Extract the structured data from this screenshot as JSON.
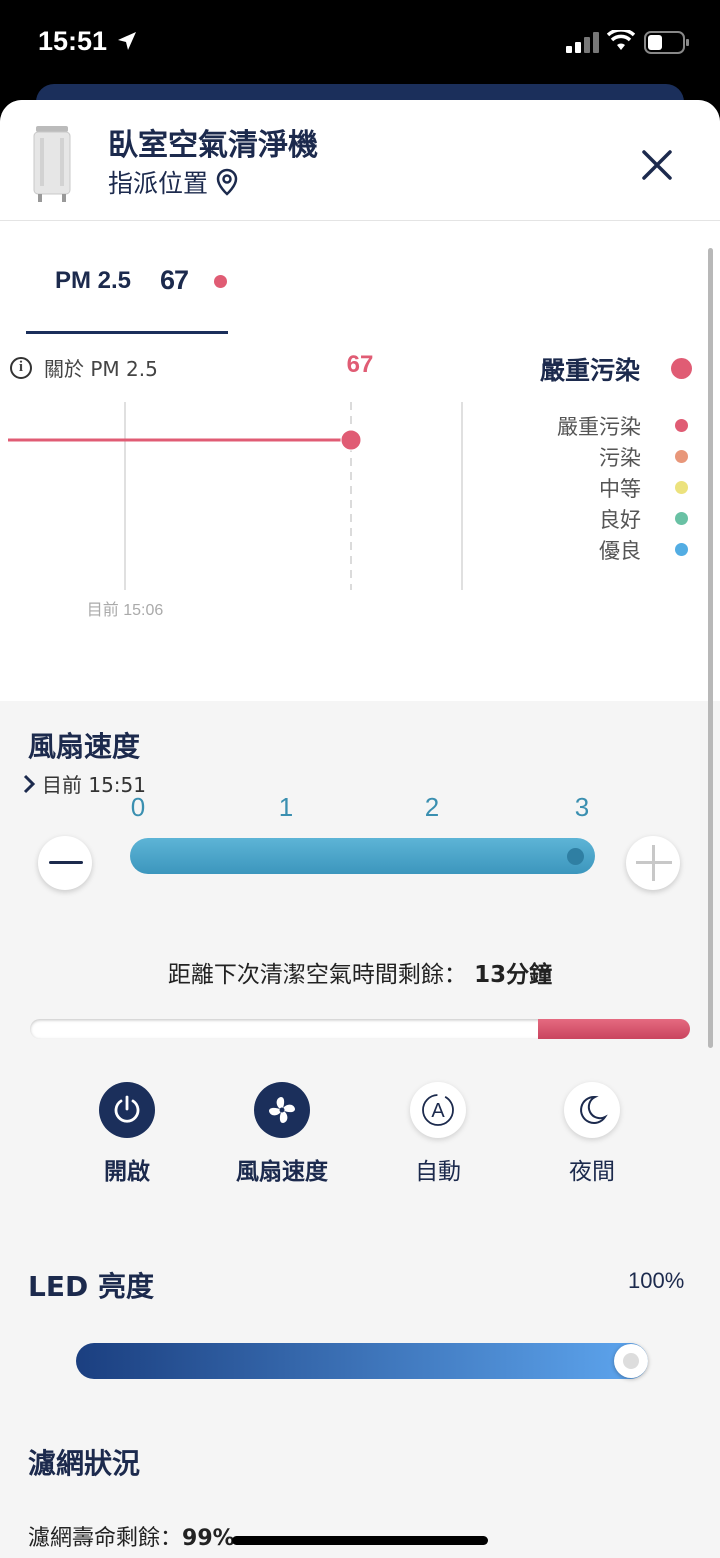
{
  "status_bar": {
    "time": "15:51"
  },
  "header": {
    "device_name": "臥室空氣清淨機",
    "location_label": "指派位置"
  },
  "pm_tab": {
    "label": "PM 2.5",
    "value": "67"
  },
  "chart_header": {
    "about_label": "關於 PM 2.5",
    "current_value": "67",
    "status": "嚴重污染"
  },
  "chart_data": {
    "type": "line",
    "x_tick_labels": [
      "目前 15:06"
    ],
    "series": [
      {
        "values": [
          67
        ]
      }
    ],
    "current_value": 67
  },
  "legend": [
    {
      "label": "嚴重污染",
      "color": "#e05c74"
    },
    {
      "label": "污染",
      "color": "#e8977a"
    },
    {
      "label": "中等",
      "color": "#ece27d"
    },
    {
      "label": "良好",
      "color": "#69c1a4"
    },
    {
      "label": "優良",
      "color": "#53ade3"
    }
  ],
  "now_label": "目前 15:51",
  "fan": {
    "title": "風扇速度",
    "speeds": [
      "0",
      "1",
      "2",
      "3"
    ],
    "current_speed": 3
  },
  "clean": {
    "text": "距離下次清潔空氣時間剩餘：",
    "remaining": "13分鐘",
    "remaining_fraction": 0.23
  },
  "modes": [
    {
      "label": "開啟",
      "icon": "power-icon",
      "active": true
    },
    {
      "label": "風扇速度",
      "icon": "fan-icon",
      "active": true
    },
    {
      "label": "自動",
      "icon": "auto-icon",
      "active": false
    },
    {
      "label": "夜間",
      "icon": "moon-icon",
      "active": false
    }
  ],
  "led": {
    "title": "LED 亮度",
    "value": "100%",
    "level": 1.0
  },
  "filter": {
    "title": "濾網狀況",
    "life_label": "濾網壽命剩餘：",
    "life_value": "99%"
  }
}
